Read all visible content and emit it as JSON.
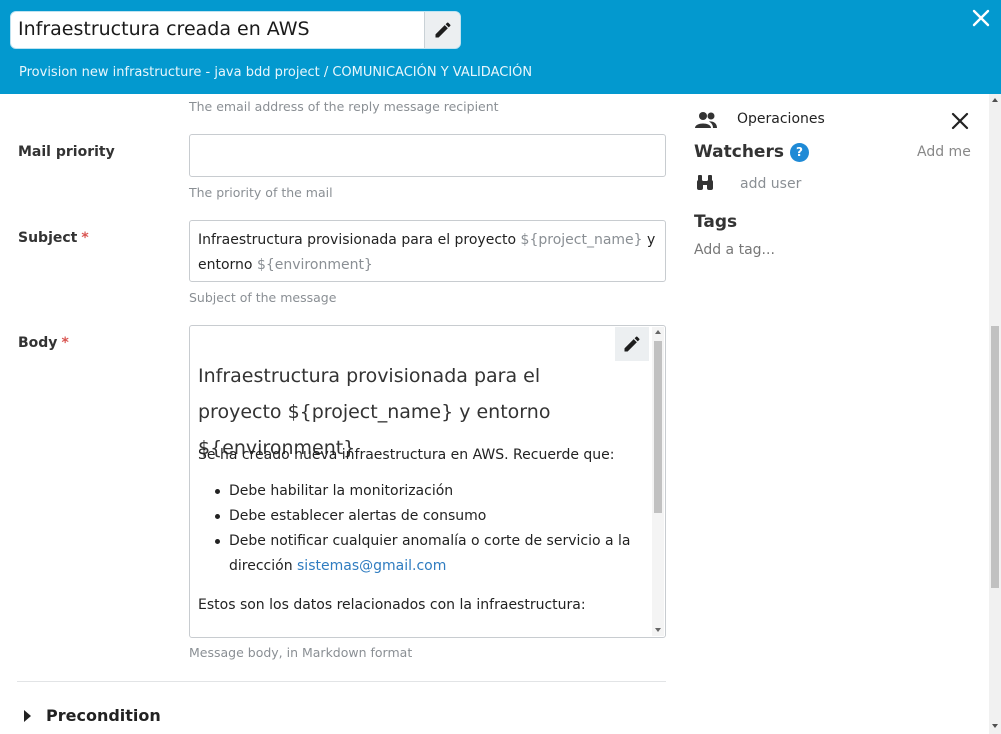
{
  "header": {
    "title": "Infraestructura creada en AWS",
    "breadcrumb": "Provision new infrastructure - java bdd project / COMUNICACIÓN Y VALIDACIÓN",
    "bg_color": "#0399cf"
  },
  "form": {
    "reply_hint": "The email address of the reply message recipient",
    "mail_priority": {
      "label": "Mail priority",
      "value": "",
      "hint": "The priority of the mail"
    },
    "subject": {
      "label": "Subject",
      "required_mark": "*",
      "text_1": "Infraestructura provisionada para el proyecto ",
      "var_1": "${project_name}",
      "text_2": " y entorno ",
      "var_2": "${environment}",
      "hint": "Subject of the message"
    },
    "body": {
      "label": "Body",
      "required_mark": "*",
      "heading": "Infraestructura provisionada para el proyecto ${project_name} y entorno ${environment}",
      "intro": "Se ha creado nueva infraestructura en AWS. Recuerde que:",
      "bullets": [
        "Debe habilitar la monitorización",
        "Debe establecer alertas de consumo",
        "Debe notificar cualquier anomalía o corte de servicio a la dirección "
      ],
      "email_link": "sistemas@gmail.com",
      "footer": "Estos son los datos relacionados con la infraestructura:",
      "hint": "Message body, in Markdown format"
    },
    "precondition": "Precondition"
  },
  "sidebar": {
    "team": "Operaciones",
    "watchers_title": "Watchers",
    "help_glyph": "?",
    "add_me": "Add me",
    "add_user": "add user",
    "tags_title": "Tags",
    "add_tag": "Add a tag..."
  }
}
